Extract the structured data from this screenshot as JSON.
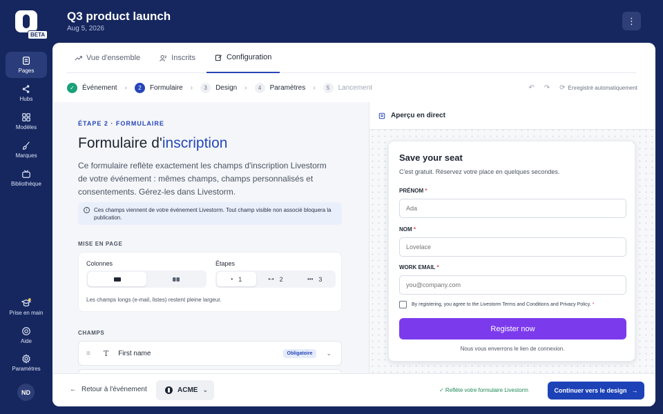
{
  "rail": {
    "logo_badge": "BETA",
    "items": [
      {
        "label": "Pages",
        "icon": "pages-icon"
      },
      {
        "label": "Hubs",
        "icon": "share-icon"
      },
      {
        "label": "Modèles",
        "icon": "grid-icon"
      },
      {
        "label": "Marques",
        "icon": "brush-icon"
      },
      {
        "label": "Bibliothèque",
        "icon": "tv-icon"
      }
    ],
    "bottom_items": [
      {
        "label": "Prise en main",
        "icon": "graduation-cap-icon"
      },
      {
        "label": "Aide",
        "icon": "help-icon"
      },
      {
        "label": "Paramètres",
        "icon": "gear-icon"
      }
    ],
    "avatar": "ND"
  },
  "header": {
    "title": "Q3 product launch",
    "date": "Aug 5, 2026",
    "more": "⋮"
  },
  "tabs": [
    {
      "label": "Vue d'ensemble",
      "icon": "trend-icon"
    },
    {
      "label": "Inscrits",
      "icon": "users-icon"
    },
    {
      "label": "Configuration",
      "icon": "edit-icon"
    }
  ],
  "stepper": {
    "steps": [
      {
        "num": "✓",
        "label": "Événement"
      },
      {
        "num": "2",
        "label": "Formulaire"
      },
      {
        "num": "3",
        "label": "Design"
      },
      {
        "num": "4",
        "label": "Paramètres"
      },
      {
        "num": "5",
        "label": "Lancement"
      }
    ],
    "autosave": "Enregistré automatiquement"
  },
  "left": {
    "eyebrow": "ÉTAPE 2 · FORMULAIRE",
    "title_plain": "Formulaire d'",
    "title_accent": "inscription",
    "lede": "Ce formulaire reflète exactement les champs d'inscription Livestorm de votre événement : mêmes champs, champs personnalisés et consentements. Gérez-les dans Livestorm.",
    "info": "Ces champs viennent de votre événement Livestorm. Tout champ visible non associé bloquera la publication.",
    "layout_label": "MISE EN PAGE",
    "columns_label": "Colonnes",
    "steps_label": "Étapes",
    "steps_options": [
      "1",
      "2",
      "3"
    ],
    "layout_note": "Les champs longs (e-mail, listes) restent pleine largeur.",
    "fields_label": "CHAMPS",
    "fields": [
      {
        "name": "First name",
        "badge": "Obligatoire"
      }
    ]
  },
  "preview": {
    "header": "Aperçu en direct",
    "form": {
      "title": "Save your seat",
      "subtitle": "C'est gratuit. Réservez votre place en quelques secondes.",
      "fields": [
        {
          "label": "PRÉNOM",
          "placeholder": "Ada"
        },
        {
          "label": "NOM",
          "placeholder": "Lovelace"
        },
        {
          "label": "WORK EMAIL",
          "placeholder": "you@company.com"
        }
      ],
      "required_mark": "*",
      "consent": "By registering, you agree to the Livestorm Terms and Conditions and Privacy Policy.",
      "button": "Register now",
      "footnote": "Nous vous enverrons le lien de connexion."
    }
  },
  "footer": {
    "back": "Retour à l'événement",
    "brand": "ACME",
    "status": "✓ Reflète votre formulaire Livestorm",
    "continue": "Continuer vers le design"
  },
  "colors": {
    "navy": "#16275f",
    "primary": "#1d42b7",
    "register": "#7c3aed",
    "success": "#1aa179"
  }
}
